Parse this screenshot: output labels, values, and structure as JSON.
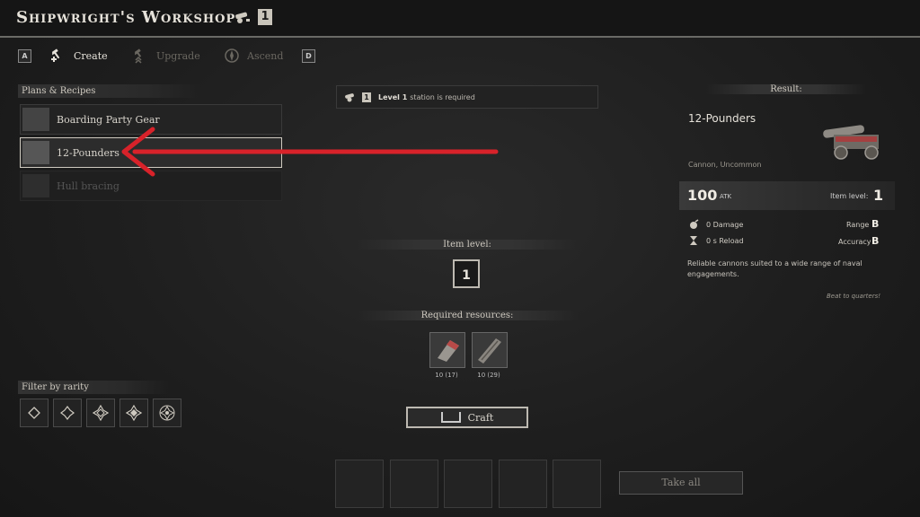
{
  "header": {
    "title": "Shipwright's Workshop",
    "station_level": "1"
  },
  "tabs": [
    {
      "key": "A",
      "label": "Create",
      "state": "active"
    },
    {
      "label": "Upgrade",
      "state": "disabled"
    },
    {
      "label": "Ascend",
      "state": "disabled"
    },
    {
      "key": "D"
    }
  ],
  "recipes": {
    "heading": "Plans & Recipes",
    "items": [
      {
        "label": "Boarding Party Gear",
        "state": "normal"
      },
      {
        "label": "12-Pounders",
        "state": "selected"
      },
      {
        "label": "Hull bracing",
        "state": "locked"
      }
    ]
  },
  "notice": {
    "level_label": "Level 1",
    "text": "station is required",
    "badge": "1"
  },
  "craft_panel": {
    "item_level_heading": "Item level:",
    "item_level_value": "1",
    "resources_heading": "Required resources:",
    "resources": [
      {
        "icon": "fabric-resource-icon",
        "quantity": "10 (17)"
      },
      {
        "icon": "wood-resource-icon",
        "quantity": "10 (29)"
      }
    ],
    "craft_label": "Craft"
  },
  "output": {
    "take_all_label": "Take all",
    "slots": 5
  },
  "filter": {
    "heading": "Filter by rarity",
    "rarities": [
      "common",
      "uncommon",
      "rare",
      "epic",
      "legendary"
    ]
  },
  "result": {
    "heading": "Result:",
    "name": "12-Pounders",
    "subtitle": "Cannon, Uncommon",
    "atk_value": "100",
    "atk_label": "ATK",
    "item_level_label": "Item level:",
    "item_level_value": "1",
    "damage": "0 Damage",
    "reload": "0 s  Reload",
    "range_label": "Range",
    "range_grade": "B",
    "accuracy_label": "Accuracy",
    "accuracy_grade": "B",
    "description": "Reliable cannons suited to a wide range of naval engagements.",
    "quote": "Beat to quarters!"
  },
  "colors": {
    "arrow": "#d8222a",
    "accent": "#cfcac0"
  }
}
